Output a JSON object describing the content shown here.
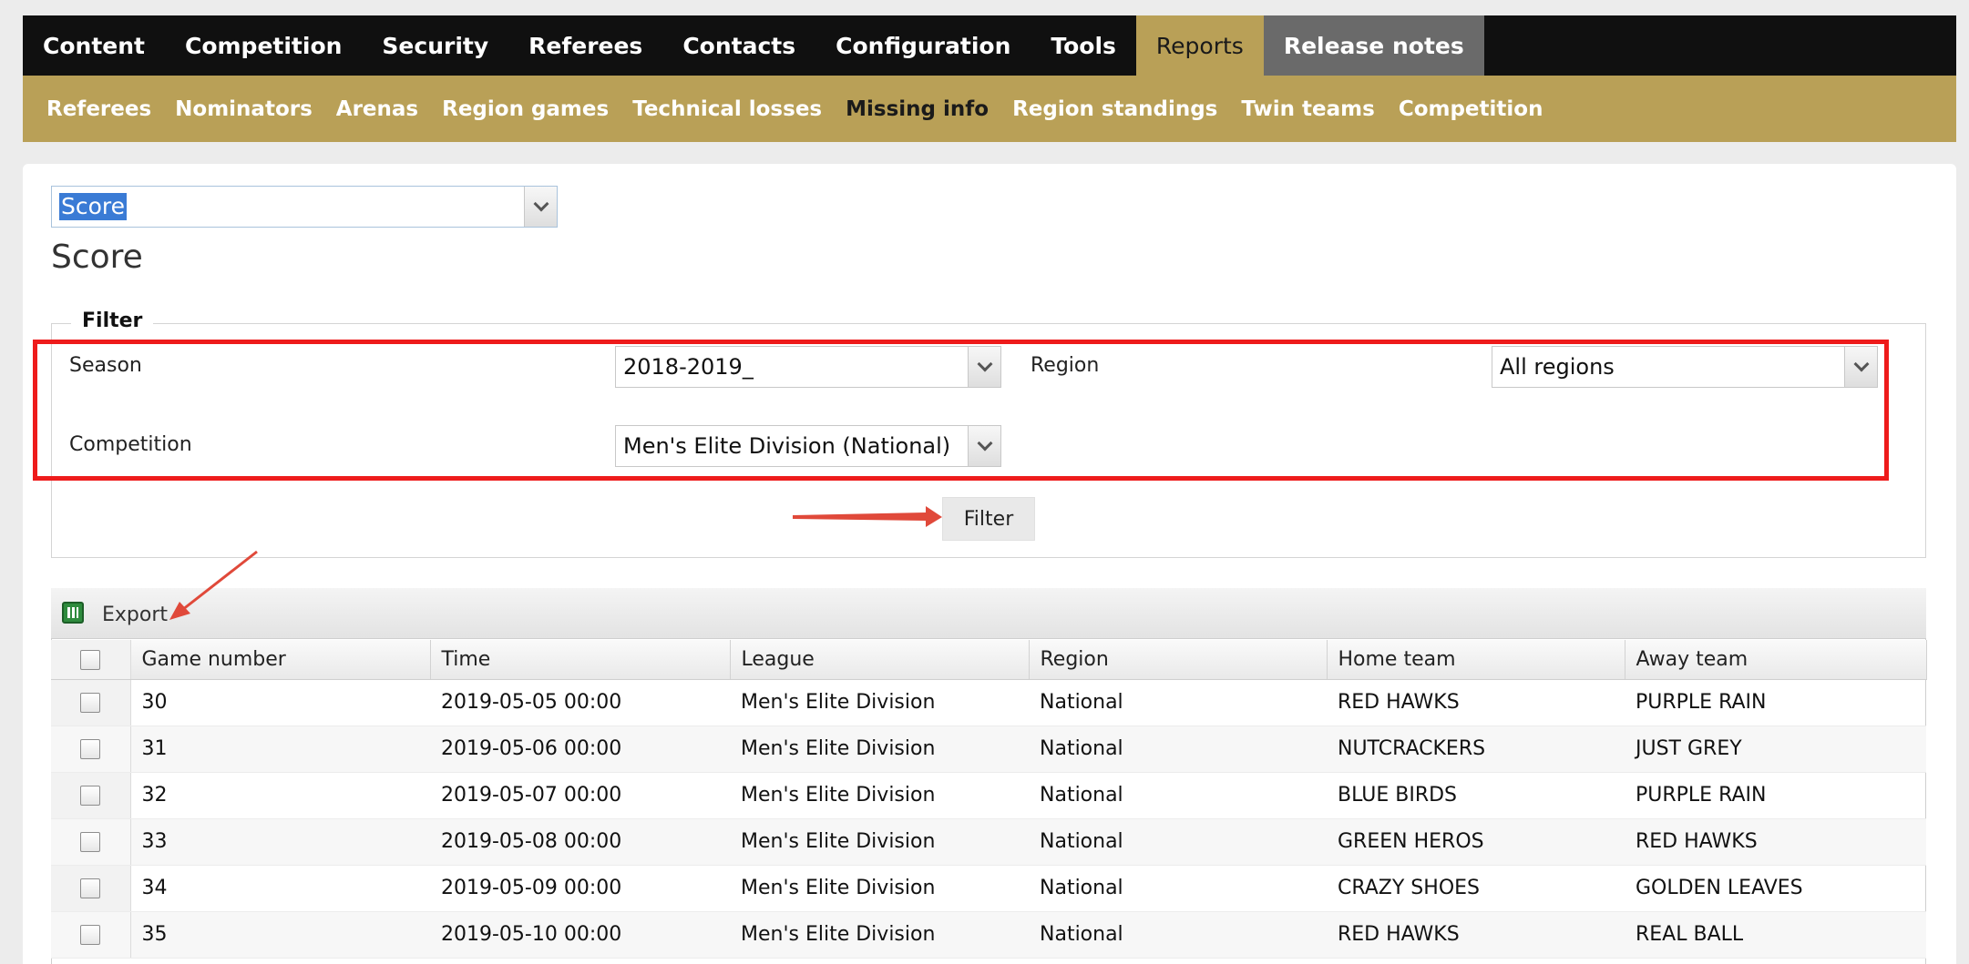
{
  "top_nav": [
    {
      "label": "Content"
    },
    {
      "label": "Competition"
    },
    {
      "label": "Security"
    },
    {
      "label": "Referees"
    },
    {
      "label": "Contacts"
    },
    {
      "label": "Configuration"
    },
    {
      "label": "Tools"
    },
    {
      "label": "Reports",
      "state": "active"
    },
    {
      "label": "Release notes",
      "state": "dim"
    }
  ],
  "sub_nav": [
    {
      "label": "Referees"
    },
    {
      "label": "Nominators"
    },
    {
      "label": "Arenas"
    },
    {
      "label": "Region games"
    },
    {
      "label": "Technical losses"
    },
    {
      "label": "Missing info",
      "state": "active"
    },
    {
      "label": "Region standings"
    },
    {
      "label": "Twin teams"
    },
    {
      "label": "Competition"
    }
  ],
  "report_select": {
    "value": "Score"
  },
  "page_title": "Score",
  "filter": {
    "legend": "Filter",
    "season_label": "Season",
    "season_value": "2018-2019_",
    "region_label": "Region",
    "region_value": "All regions",
    "competition_label": "Competition",
    "competition_value": "Men's Elite Division (National)",
    "button_label": "Filter"
  },
  "grid": {
    "export_label": "Export",
    "columns": [
      "Game number",
      "Time",
      "League",
      "Region",
      "Home team",
      "Away team"
    ],
    "rows": [
      [
        "30",
        "2019-05-05 00:00",
        "Men's Elite Division",
        "National",
        "RED HAWKS",
        "PURPLE RAIN"
      ],
      [
        "31",
        "2019-05-06 00:00",
        "Men's Elite Division",
        "National",
        "NUTCRACKERS",
        "JUST GREY"
      ],
      [
        "32",
        "2019-05-07 00:00",
        "Men's Elite Division",
        "National",
        "BLUE BIRDS",
        "PURPLE RAIN"
      ],
      [
        "33",
        "2019-05-08 00:00",
        "Men's Elite Division",
        "National",
        "GREEN HEROS",
        "RED HAWKS"
      ],
      [
        "34",
        "2019-05-09 00:00",
        "Men's Elite Division",
        "National",
        "CRAZY SHOES",
        "GOLDEN LEAVES"
      ],
      [
        "35",
        "2019-05-10 00:00",
        "Men's Elite Division",
        "National",
        "RED HAWKS",
        "REAL BALL"
      ]
    ]
  },
  "colors": {
    "nav_bg": "#101010",
    "accent_gold": "#b9a057",
    "highlight_red": "#ee1b1b",
    "arrow_red": "#e0493a"
  }
}
